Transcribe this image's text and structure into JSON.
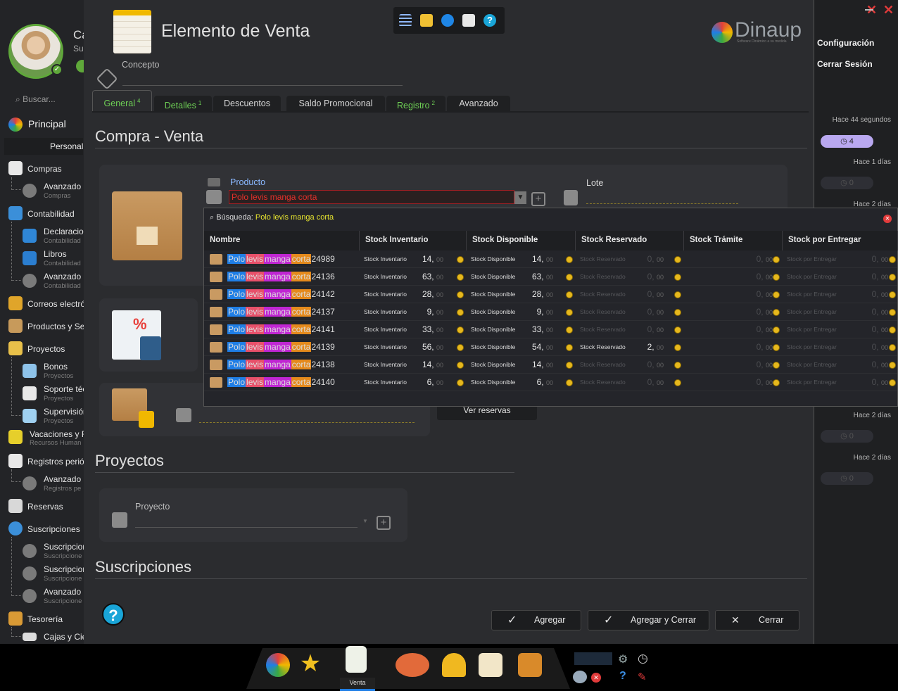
{
  "sidebar": {
    "user_name": "Ca",
    "user_sub": "Sup",
    "search_placeholder": "Buscar...",
    "principal": "Principal",
    "personal": "Personal",
    "items": [
      {
        "label": "Compras"
      },
      {
        "label": "Contabilidad"
      },
      {
        "label": "Correos electró"
      },
      {
        "label": "Productos y Ser"
      },
      {
        "label": "Proyectos"
      },
      {
        "label": "Vacaciones y Fe",
        "sub": "Recursos Human"
      },
      {
        "label": "Registros perió"
      },
      {
        "label": "Reservas"
      },
      {
        "label": "Suscripciones"
      },
      {
        "label": "Tesorería"
      }
    ],
    "subs": [
      {
        "label": "Avanzado",
        "sub": "Compras"
      },
      {
        "label": "Declaracion",
        "sub": "Contabilidad"
      },
      {
        "label": "Libros",
        "sub": "Contabilidad"
      },
      {
        "label": "Avanzado",
        "sub": "Contabilidad"
      },
      {
        "label": "Bonos",
        "sub": "Proyectos"
      },
      {
        "label": "Soporte téc",
        "sub": "Proyectos"
      },
      {
        "label": "Supervisión",
        "sub": "Proyectos"
      },
      {
        "label": "Avanzado",
        "sub": "Registros pe"
      },
      {
        "label": "Suscripcion",
        "sub": "Suscripcione"
      },
      {
        "label": "Suscripcion",
        "sub": "Suscripcione"
      },
      {
        "label": "Avanzado",
        "sub": "Suscripcione"
      },
      {
        "label": "Cajas y Cier"
      }
    ]
  },
  "window": {
    "title": "Elemento de Venta",
    "concept_label": "Concepto",
    "brand": "Dinaup",
    "brand_tagline": "Software Dinámico a su medida",
    "tabs": [
      {
        "label": "General",
        "badge": "4"
      },
      {
        "label": "Detalles",
        "badge": "1"
      },
      {
        "label": "Descuentos",
        "badge": ""
      },
      {
        "label": "Saldo Promocional",
        "badge": ""
      },
      {
        "label": "Registro",
        "badge": "2"
      },
      {
        "label": "Avanzado",
        "badge": ""
      }
    ],
    "section_compra": "Compra - Venta",
    "producto_label": "Producto",
    "producto_value": "Polo levis manga corta",
    "lote_label": "Lote",
    "ver_reservas": "Ver reservas",
    "section_proyectos": "Proyectos",
    "proyecto_label": "Proyecto",
    "section_suscripciones": "Suscripciones",
    "buttons": {
      "agregar": "Agregar",
      "agregar_cerrar": "Agregar y Cerrar",
      "cerrar": "Cerrar"
    }
  },
  "dropdown": {
    "search_label": "Búsqueda:",
    "search_value": "Polo levis manga corta",
    "columns": [
      "Nombre",
      "Stock Inventario",
      "Stock Disponible",
      "Stock Reservado",
      "Stock Trámite",
      "Stock por Entregar"
    ],
    "cell_labels": {
      "inv": "Stock Inventario",
      "disp": "Stock Disponible",
      "res": "Stock Reservado",
      "ent": "Stock por Entregar"
    },
    "name_parts": [
      "Polo",
      "levis",
      "manga",
      "corta"
    ],
    "rows": [
      {
        "code": "24989",
        "inv": "14,",
        "disp": "14,",
        "res": "0,",
        "tram": "0,",
        "ent": "0,",
        "res_active": false
      },
      {
        "code": "24136",
        "inv": "63,",
        "disp": "63,",
        "res": "0,",
        "tram": "0,",
        "ent": "0,",
        "res_active": false
      },
      {
        "code": "24142",
        "inv": "28,",
        "disp": "28,",
        "res": "0,",
        "tram": "0,",
        "ent": "0,",
        "res_active": false
      },
      {
        "code": "24137",
        "inv": "9,",
        "disp": "9,",
        "res": "0,",
        "tram": "0,",
        "ent": "0,",
        "res_active": false
      },
      {
        "code": "24141",
        "inv": "33,",
        "disp": "33,",
        "res": "0,",
        "tram": "0,",
        "ent": "0,",
        "res_active": false
      },
      {
        "code": "24139",
        "inv": "56,",
        "disp": "54,",
        "res": "2,",
        "tram": "0,",
        "ent": "0,",
        "res_active": true
      },
      {
        "code": "24138",
        "inv": "14,",
        "disp": "14,",
        "res": "0,",
        "tram": "0,",
        "ent": "0,",
        "res_active": false
      },
      {
        "code": "24140",
        "inv": "6,",
        "disp": "6,",
        "res": "0,",
        "tram": "0,",
        "ent": "0,",
        "res_active": false
      }
    ],
    "decimals": "00"
  },
  "right": {
    "config": "Configuración",
    "logout": "Cerrar Sesión",
    "times": [
      "Hace 44 segundos",
      "Hace 1 días",
      "Hace 2 días",
      "Hace 2 días",
      "Hace 2 días"
    ],
    "counts": [
      "4",
      "0",
      "0",
      "0"
    ]
  },
  "taskbar": {
    "active_label": "Venta"
  },
  "colors": {
    "polo": "#1f7ee6",
    "levis": "#e8506a",
    "manga": "#c026d3",
    "corta": "#e58a1c",
    "accent_green": "#6ecf55",
    "close_red": "#e23b3b"
  }
}
